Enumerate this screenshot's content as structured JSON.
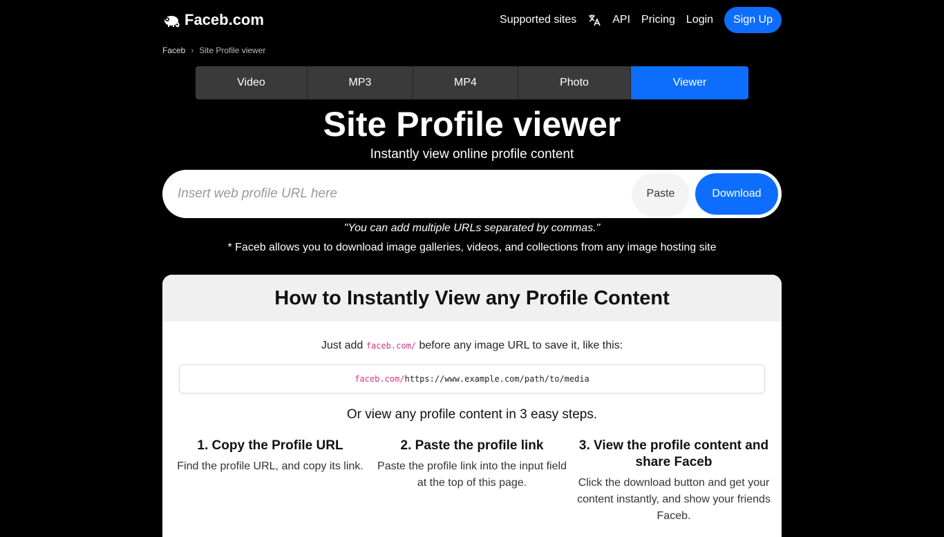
{
  "header": {
    "logo_text": "Faceb.com",
    "nav": [
      {
        "label": "Supported sites"
      },
      {
        "label": "API"
      },
      {
        "label": "Pricing"
      },
      {
        "label": "Login"
      }
    ],
    "signup_label": "Sign Up"
  },
  "breadcrumb": {
    "home": "Faceb",
    "separator": "›",
    "current": "Site Profile viewer"
  },
  "tabs": [
    {
      "label": "Video"
    },
    {
      "label": "MP3"
    },
    {
      "label": "MP4"
    },
    {
      "label": "Photo"
    },
    {
      "label": "Viewer"
    }
  ],
  "hero": {
    "title": "Site Profile viewer",
    "subtitle": "Instantly view online profile content"
  },
  "search": {
    "placeholder": "Insert web profile URL here",
    "value": "",
    "paste_label": "Paste",
    "download_label": "Download"
  },
  "hint": "\"You can add multiple URLs separated by commas.\"",
  "note": "* Faceb allows you to download image galleries, videos, and collections from any image hosting site",
  "howto": {
    "title": "How to Instantly View any Profile Content",
    "intro_before": "Just add ",
    "intro_code": "faceb.com/",
    "intro_after": " before any image URL to save it, like this:",
    "example_prefix": "faceb.com/",
    "example_url": "https://www.example.com/path/to/media",
    "steps_title": "Or view any profile content in 3 easy steps.",
    "steps": [
      {
        "title": "1. Copy the Profile URL",
        "text": "Find the profile URL, and copy its link."
      },
      {
        "title": "2. Paste the profile link",
        "text": "Paste the profile link into the input field at the top of this page."
      },
      {
        "title": "3. View the profile content and share Faceb",
        "text": "Click the download button and get your content instantly, and show your friends Faceb."
      }
    ]
  },
  "colors": {
    "accent": "#0d6efd",
    "background": "#000000",
    "tab_inactive": "#3a3a3a",
    "code": "#d63384"
  }
}
